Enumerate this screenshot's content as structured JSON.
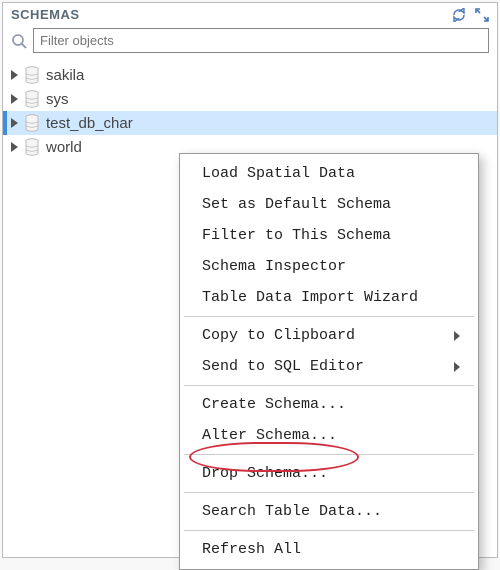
{
  "header": {
    "title": "SCHEMAS"
  },
  "search": {
    "placeholder": "Filter objects"
  },
  "tree": {
    "items": [
      {
        "label": "sakila"
      },
      {
        "label": "sys"
      },
      {
        "label": "test_db_char"
      },
      {
        "label": "world"
      }
    ]
  },
  "context_menu": {
    "items": [
      {
        "label": "Load Spatial Data"
      },
      {
        "label": "Set as Default Schema"
      },
      {
        "label": "Filter to This Schema"
      },
      {
        "label": "Schema Inspector"
      },
      {
        "label": "Table Data Import Wizard"
      },
      {
        "separator": true
      },
      {
        "label": "Copy to Clipboard",
        "submenu": true
      },
      {
        "label": "Send to SQL Editor",
        "submenu": true
      },
      {
        "separator": true
      },
      {
        "label": "Create Schema..."
      },
      {
        "label": "Alter Schema..."
      },
      {
        "separator": true
      },
      {
        "label": "Drop Schema..."
      },
      {
        "separator": true
      },
      {
        "label": "Search Table Data..."
      },
      {
        "separator": true
      },
      {
        "label": "Refresh All"
      }
    ]
  },
  "colors": {
    "selection": "#cfe8ff",
    "highlight": "#d03040"
  }
}
